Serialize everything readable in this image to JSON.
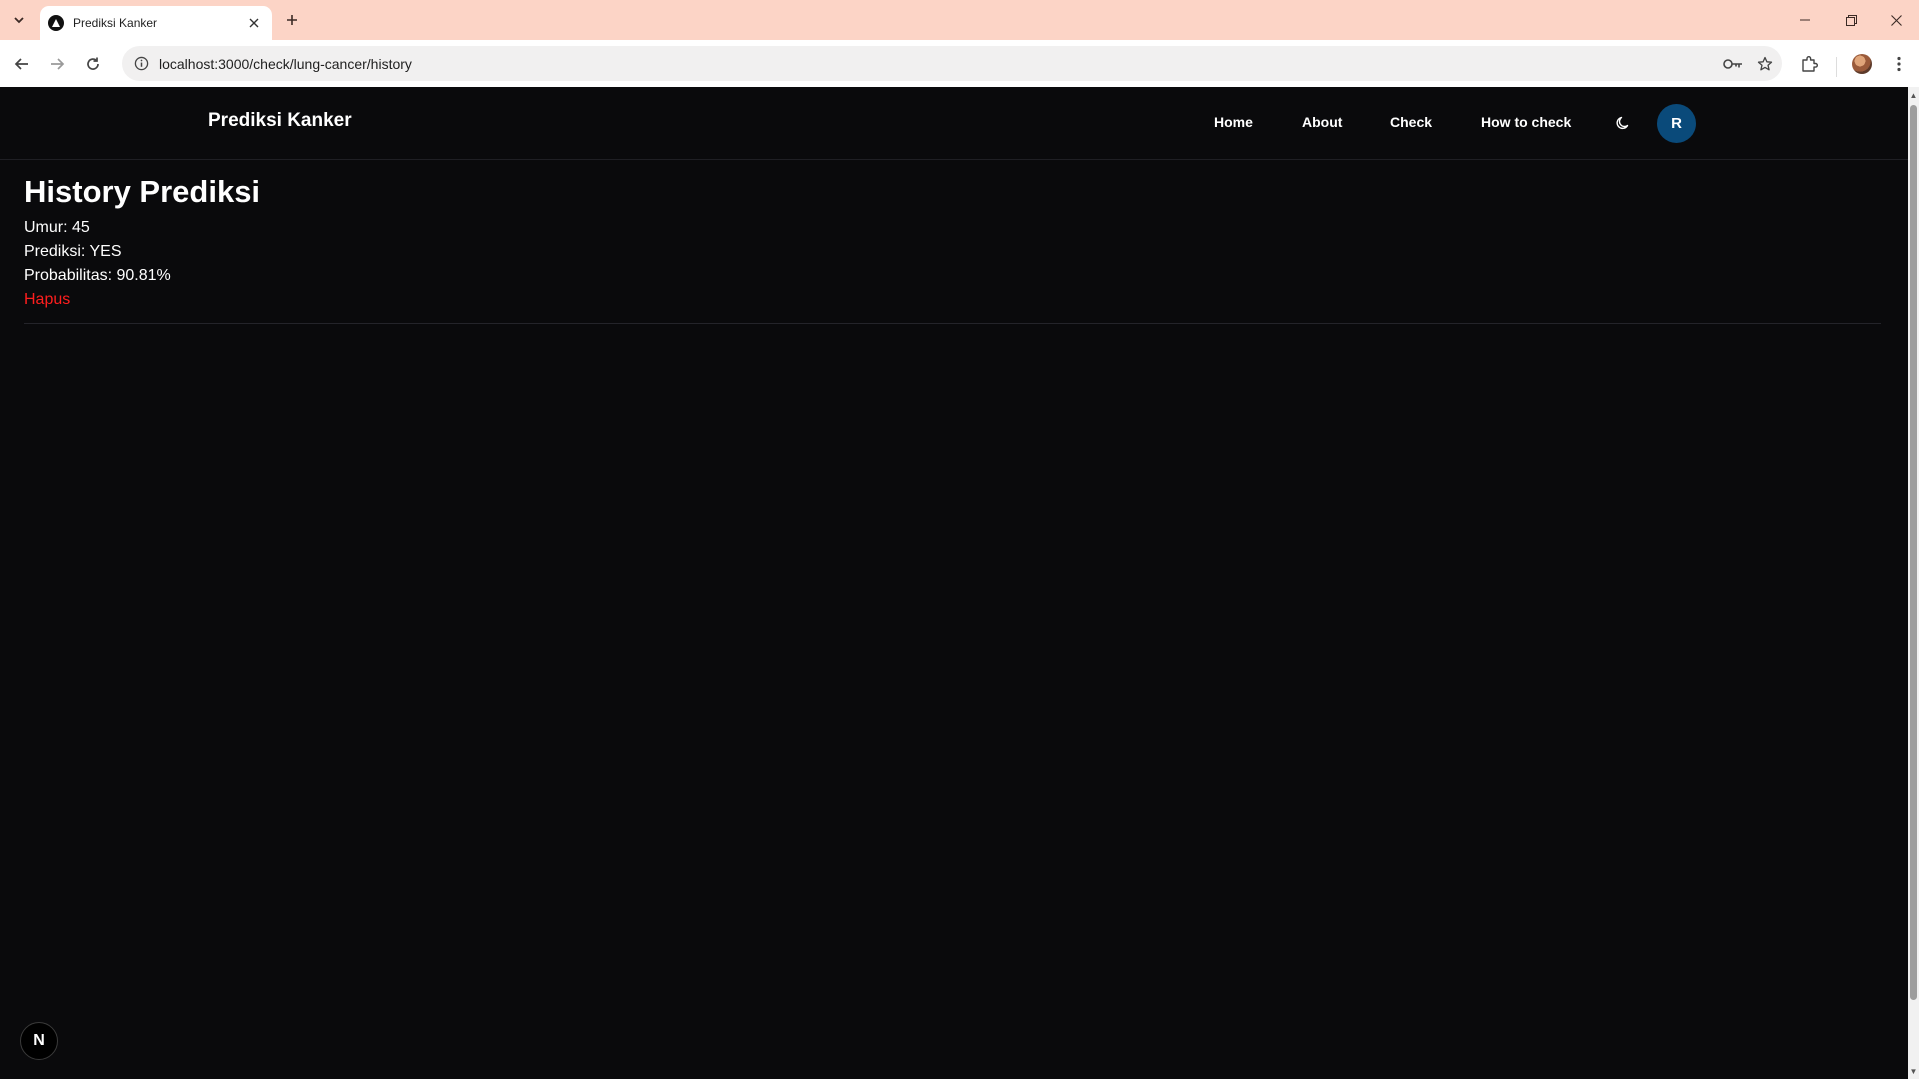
{
  "browser": {
    "tab_title": "Prediksi Kanker",
    "url": "localhost:3000/check/lung-cancer/history",
    "icons": {
      "tab_search": "chevron-down-icon",
      "favicon": "nextjs-triangle-icon",
      "tab_close": "close-icon",
      "new_tab": "plus-icon",
      "minimize": "minimize-icon",
      "restore": "restore-icon",
      "close_window": "close-icon",
      "back": "arrow-left-icon",
      "forward": "arrow-right-icon",
      "reload": "reload-icon",
      "site_info": "info-icon",
      "password": "key-icon",
      "bookmark": "star-icon",
      "extensions": "puzzle-icon",
      "menu": "kebab-icon"
    }
  },
  "site": {
    "brand": "Prediksi Kanker",
    "nav": [
      {
        "label": "Home"
      },
      {
        "label": "About"
      },
      {
        "label": "Check"
      },
      {
        "label": "How to check"
      }
    ],
    "theme_toggle_icon": "moon-icon",
    "avatar_initial": "R",
    "avatar_color": "#0a4a7a"
  },
  "page": {
    "title": "History Prediksi",
    "history": [
      {
        "umur": "Umur: 45",
        "prediksi": "Prediksi: YES",
        "probabilitas": "Probabilitas: 90.81%",
        "delete_label": "Hapus"
      }
    ],
    "delete_color": "#ff1e1e"
  },
  "dev_badge": {
    "label": "N"
  }
}
